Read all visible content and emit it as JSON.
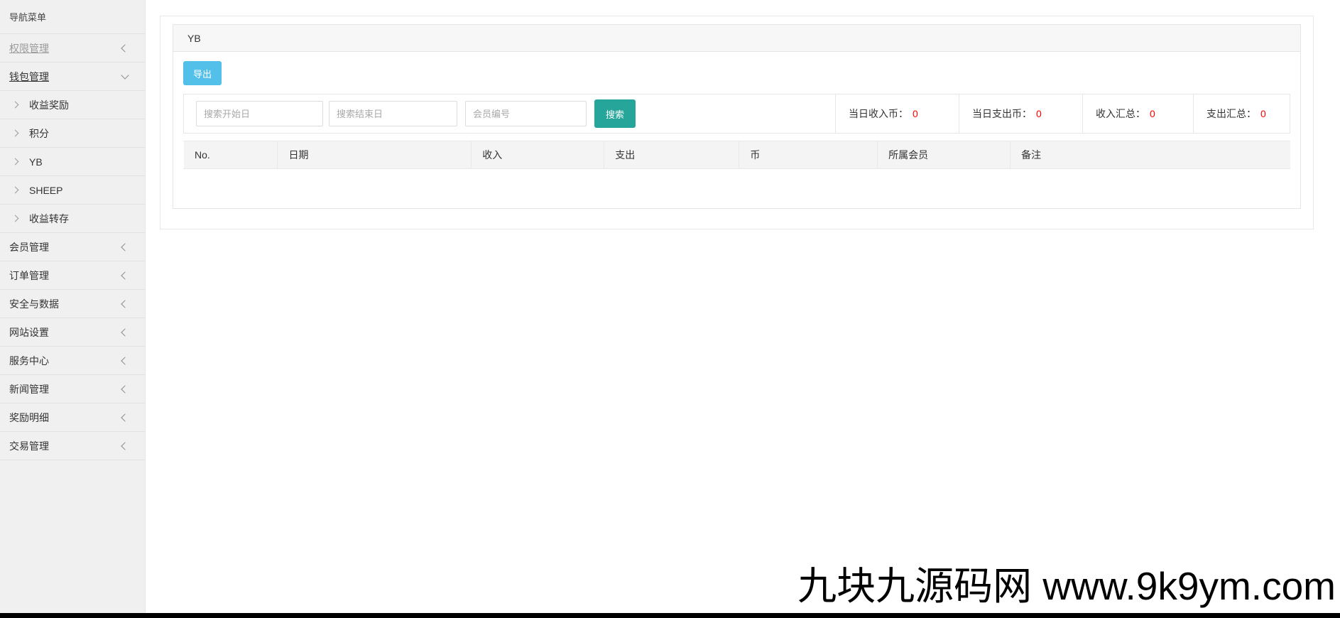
{
  "sidebar": {
    "header": "导航菜单",
    "items": [
      {
        "label": "权限管理",
        "type": "group",
        "chevron": "left",
        "muted": true,
        "underline": true
      },
      {
        "label": "钱包管理",
        "type": "group",
        "chevron": "down",
        "underline": true
      },
      {
        "label": "收益奖励",
        "type": "sub"
      },
      {
        "label": "积分",
        "type": "sub"
      },
      {
        "label": "YB",
        "type": "sub"
      },
      {
        "label": "SHEEP",
        "type": "sub"
      },
      {
        "label": "收益转存",
        "type": "sub"
      },
      {
        "label": "会员管理",
        "type": "group",
        "chevron": "left"
      },
      {
        "label": "订单管理",
        "type": "group",
        "chevron": "left"
      },
      {
        "label": "安全与数据",
        "type": "group",
        "chevron": "left"
      },
      {
        "label": "网站设置",
        "type": "group",
        "chevron": "left"
      },
      {
        "label": "服务中心",
        "type": "group",
        "chevron": "left"
      },
      {
        "label": "新闻管理",
        "type": "group",
        "chevron": "left"
      },
      {
        "label": "奖励明细",
        "type": "group",
        "chevron": "left"
      },
      {
        "label": "交易管理",
        "type": "group",
        "chevron": "left"
      }
    ]
  },
  "panel": {
    "title": "YB",
    "export_label": "导出"
  },
  "filters": {
    "start_placeholder": "搜索开始日",
    "end_placeholder": "搜索结束日",
    "member_placeholder": "会员编号",
    "start_value": "",
    "end_value": "",
    "member_value": "",
    "search_label": "搜索"
  },
  "stats": [
    {
      "label": "当日收入币：",
      "value": "0"
    },
    {
      "label": "当日支出币：",
      "value": "0"
    },
    {
      "label": "收入汇总：",
      "value": "0"
    },
    {
      "label": "支出汇总：",
      "value": "0"
    }
  ],
  "table": {
    "headers": [
      "No.",
      "日期",
      "收入",
      "支出",
      "币",
      "所属会员",
      "备注"
    ],
    "rows": []
  },
  "watermark": "九块九源码网 www.9k9ym.com",
  "colors": {
    "export_button": "#53c0e9",
    "search_button": "#26a69a",
    "stat_value": "#ff0000",
    "sidebar_bg": "#f0f0f0",
    "panel_header_bg": "#f7f7f7",
    "table_header_bg": "#f4f4f4"
  }
}
